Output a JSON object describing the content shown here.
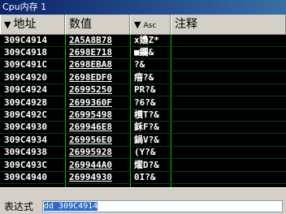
{
  "window": {
    "title": "Cpu内存 1"
  },
  "columns": {
    "address": "地址",
    "value": "数值",
    "ascii": "Asc",
    "comment": "注释",
    "sort_glyph": "▼"
  },
  "rows": [
    {
      "address": "309C4914",
      "value": "2A5A8B78",
      "ascii": "x嬝Z*"
    },
    {
      "address": "309C4918",
      "value": "2698E718",
      "ascii": "■鑭&"
    },
    {
      "address": "309C491C",
      "value": "2698EBA8",
      "ascii": "  ?&"
    },
    {
      "address": "309C4920",
      "value": "2698EDF0",
      "ascii": "瘖?&"
    },
    {
      "address": "309C4924",
      "value": "26995250",
      "ascii": "PR?&"
    },
    {
      "address": "309C4928",
      "value": "2699360F",
      "ascii": "?6?&"
    },
    {
      "address": "309C492C",
      "value": "26995498",
      "ascii": "樌T?&"
    },
    {
      "address": "309C4930",
      "value": "269946E8",
      "ascii": "鉌F?&"
    },
    {
      "address": "309C4934",
      "value": "269956E0",
      "ascii": "鍋V?&"
    },
    {
      "address": "309C4938",
      "value": "26995928",
      "ascii": "(Y?&"
    },
    {
      "address": "309C493C",
      "value": "269944A0",
      "ascii": "燿D?&"
    },
    {
      "address": "309C4940",
      "value": "26994930",
      "ascii": "0I?&"
    }
  ],
  "footer": {
    "expression_label": "表达式",
    "expression_value": "dd 309C4914"
  },
  "colors": {
    "grid_bg": "#000000",
    "grid_text": "#ffffff",
    "grid_lines": "#00c000",
    "title_bg": "#0a246a"
  }
}
